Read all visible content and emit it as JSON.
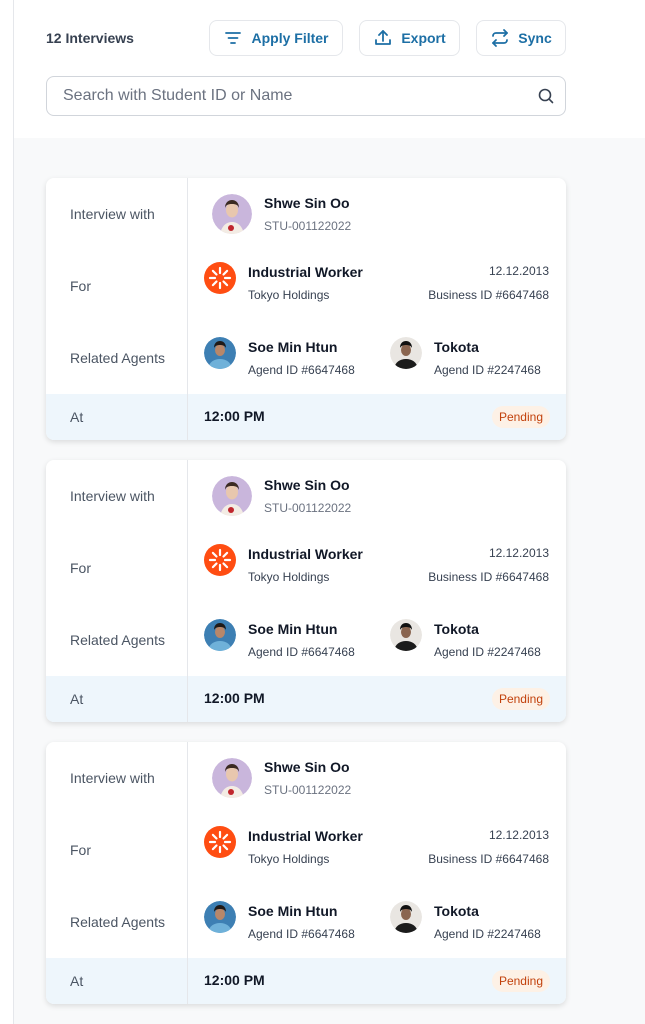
{
  "header": {
    "interview_count": "12 Interviews",
    "buttons": {
      "filter": "Apply Filter",
      "export": "Export",
      "sync": "Sync"
    }
  },
  "search": {
    "placeholder": "Search with Student ID or Name",
    "value": ""
  },
  "colors": {
    "accent": "#1d6fa5",
    "pending_bg": "#fdf1e6",
    "pending_text": "#c2410c",
    "company_logo": "#ff4d12",
    "at_row_bg": "#eef6fc"
  },
  "labels": {
    "interview_with": "Interview with",
    "for": "For",
    "related_agents": "Related Agents",
    "at": "At"
  },
  "interviews": [
    {
      "student": {
        "name": "Shwe Sin Oo",
        "id": "STU-001122022",
        "avatar_icon": "student-avatar-icon"
      },
      "job": {
        "title": "Industrial Worker",
        "company": "Tokyo Holdings",
        "date": "12.12.2013",
        "business_id": "Business ID #6647468",
        "logo_icon": "sunburst-logo-icon"
      },
      "agents": [
        {
          "name": "Soe Min Htun",
          "id": "Agend ID #6647468"
        },
        {
          "name": "Tokota",
          "id": "Agend ID #2247468"
        }
      ],
      "time": "12:00 PM",
      "status": "Pending"
    },
    {
      "student": {
        "name": "Shwe Sin Oo",
        "id": "STU-001122022",
        "avatar_icon": "student-avatar-icon"
      },
      "job": {
        "title": "Industrial Worker",
        "company": "Tokyo Holdings",
        "date": "12.12.2013",
        "business_id": "Business ID #6647468",
        "logo_icon": "sunburst-logo-icon"
      },
      "agents": [
        {
          "name": "Soe Min Htun",
          "id": "Agend ID #6647468"
        },
        {
          "name": "Tokota",
          "id": "Agend ID #2247468"
        }
      ],
      "time": "12:00 PM",
      "status": "Pending"
    },
    {
      "student": {
        "name": "Shwe Sin Oo",
        "id": "STU-001122022",
        "avatar_icon": "student-avatar-icon"
      },
      "job": {
        "title": "Industrial Worker",
        "company": "Tokyo Holdings",
        "date": "12.12.2013",
        "business_id": "Business ID #6647468",
        "logo_icon": "sunburst-logo-icon"
      },
      "agents": [
        {
          "name": "Soe Min Htun",
          "id": "Agend ID #6647468"
        },
        {
          "name": "Tokota",
          "id": "Agend ID #2247468"
        }
      ],
      "time": "12:00 PM",
      "status": "Pending"
    }
  ]
}
